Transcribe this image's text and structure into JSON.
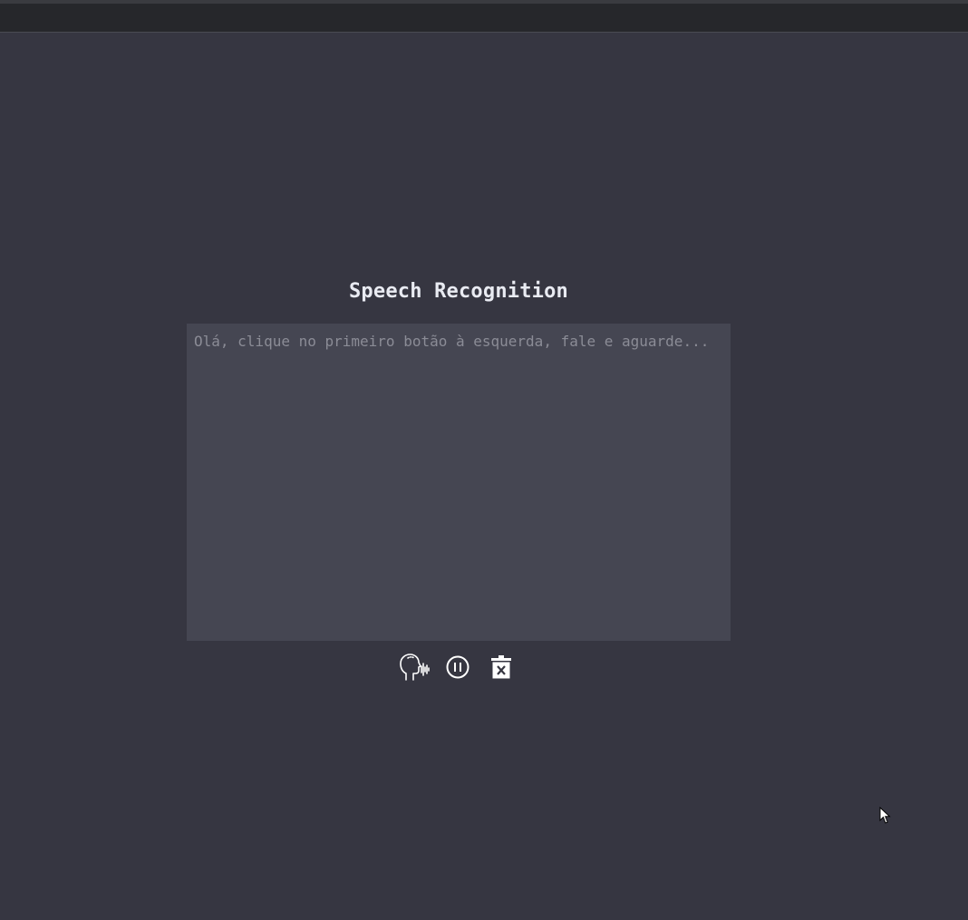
{
  "header": {},
  "main": {
    "title": "Speech Recognition",
    "transcript": {
      "value": "",
      "placeholder": "Olá, clique no primeiro botão à esquerda, fale e aguarde..."
    },
    "controls": [
      {
        "icon": "speaking-head-icon",
        "action": "start-recognition"
      },
      {
        "icon": "pause-circle-icon",
        "action": "pause-recognition"
      },
      {
        "icon": "trash-x-icon",
        "action": "clear-transcript"
      }
    ]
  },
  "colors": {
    "background": "#363641",
    "topbar": "#26272b",
    "textarea": "#454652",
    "title": "#e9ebf2",
    "placeholder": "#8b8c96",
    "icon": "#ffffff"
  }
}
